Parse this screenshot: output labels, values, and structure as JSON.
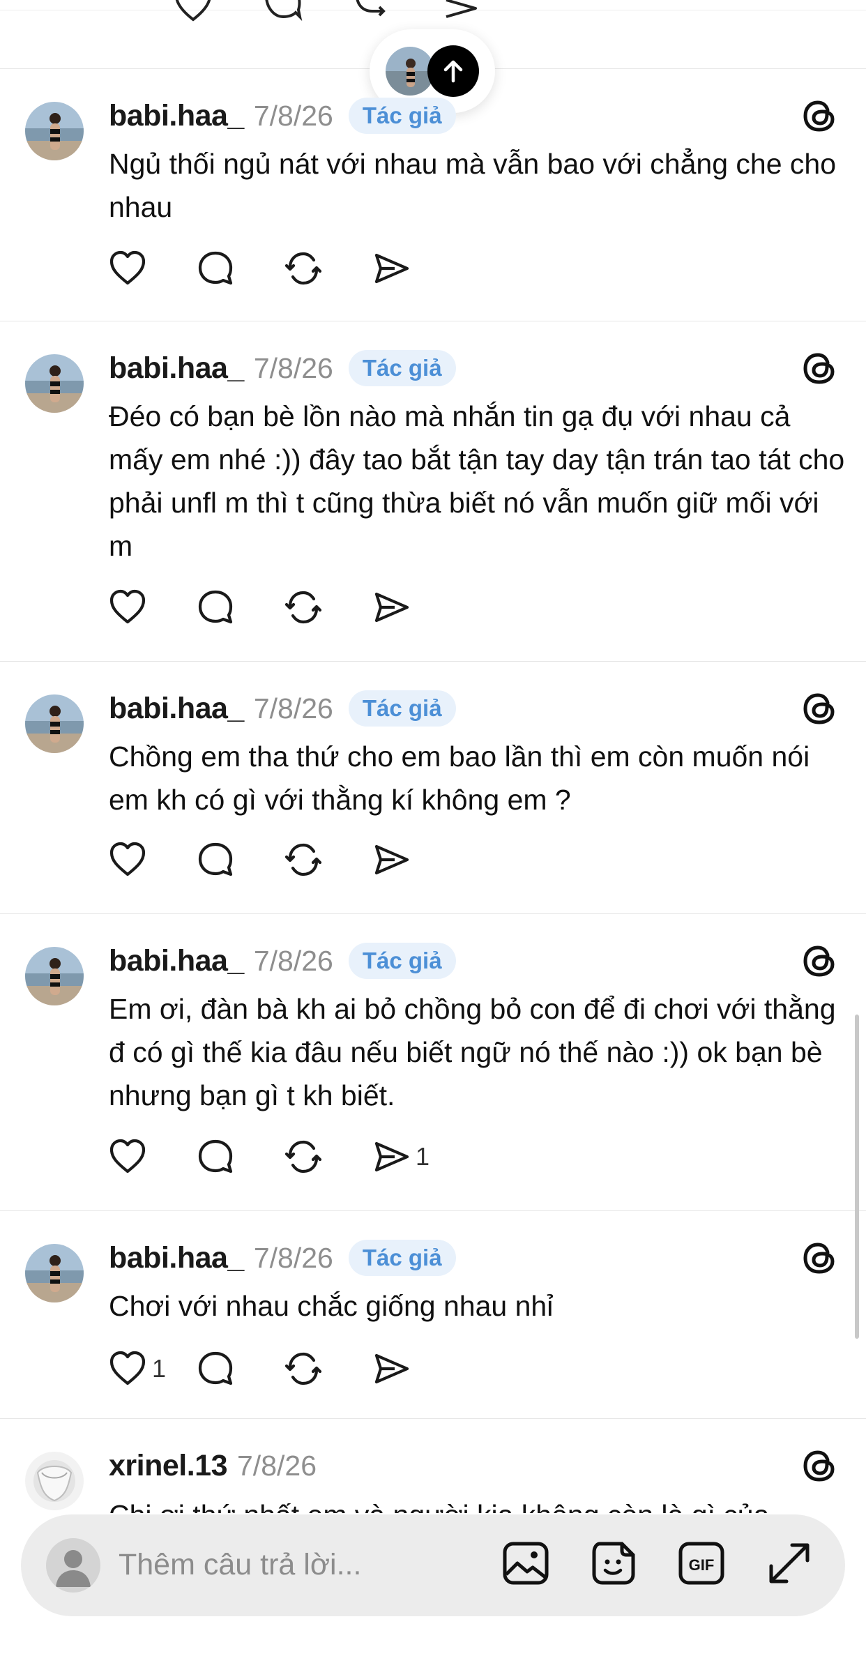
{
  "posts": [
    {
      "username": "babi.haa_",
      "date": "7/8/26",
      "badge": "Tác giả",
      "text": "Ngủ thối ngủ nát với nhau mà vẫn bao với chẳng che cho nhau",
      "like_count": "",
      "share_count": ""
    },
    {
      "username": "babi.haa_",
      "date": "7/8/26",
      "badge": "Tác giả",
      "text": "Đéo có bạn bè lồn nào mà nhắn tin gạ đụ với nhau cả mấy em nhé :)) đây tao bắt tận tay day tận trán tao tát cho phải unfl m thì t cũng thừa biết nó vẫn muốn giữ mối với m",
      "like_count": "",
      "share_count": ""
    },
    {
      "username": "babi.haa_",
      "date": "7/8/26",
      "badge": "Tác giả",
      "text": "Chồng em tha thứ cho em bao lần thì em còn muốn nói em kh có gì với thằng kí không em ?",
      "like_count": "",
      "share_count": ""
    },
    {
      "username": "babi.haa_",
      "date": "7/8/26",
      "badge": "Tác giả",
      "text": "Em ơi, đàn bà kh ai bỏ chồng bỏ con để đi chơi với thằng đ có gì thế kia đâu nếu biết ngữ nó thế nào :)) ok bạn bè nhưng bạn gì t kh biết.",
      "like_count": "",
      "share_count": "1"
    },
    {
      "username": "babi.haa_",
      "date": "7/8/26",
      "badge": "Tác giả",
      "text": "Chơi với nhau chắc giống nhau nhỉ",
      "like_count": "1",
      "share_count": ""
    },
    {
      "username": "xrinel.13",
      "date": "7/8/26",
      "badge": "",
      "text": "Chị ơi thứ nhất em và người kia không còn là gì của",
      "like_count": "",
      "share_count": ""
    }
  ],
  "reply_bar": {
    "placeholder": "Thêm câu trả lời..."
  },
  "icons": {
    "like": "heart-icon",
    "comment": "comment-icon",
    "repost": "repost-icon",
    "share": "share-icon",
    "threads": "threads-logo-icon",
    "scroll_top": "arrow-up-icon",
    "image": "image-icon",
    "sticker": "sticker-icon",
    "gif": "gif-icon",
    "expand": "expand-icon"
  },
  "colors": {
    "badge_bg": "#e8f1fb",
    "badge_text": "#4c8fd6",
    "muted": "#8e8e8e"
  }
}
